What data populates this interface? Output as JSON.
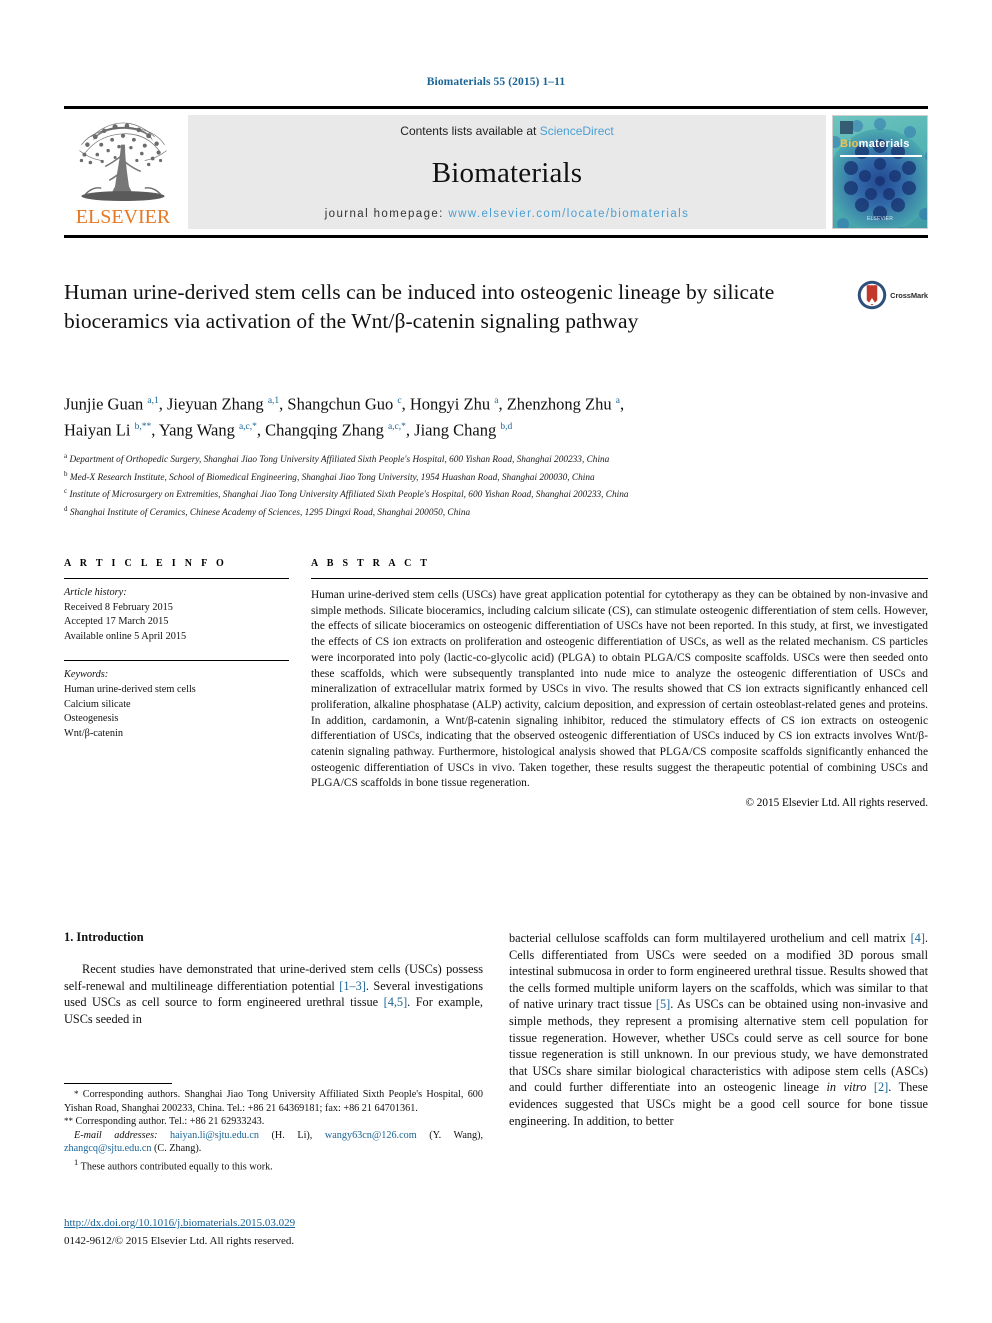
{
  "running_head": "Biomaterials 55 (2015) 1–11",
  "masthead": {
    "publisher": "ELSEVIER",
    "contents_prefix": "Contents lists available at ",
    "contents_link": "ScienceDirect",
    "journal_name": "Biomaterials",
    "homepage_prefix": "journal homepage: ",
    "homepage_url": "www.elsevier.com/locate/biomaterials",
    "cover_title_bio": "Bio",
    "cover_title_materials": "materials",
    "cover_footer": "ELSEVIER"
  },
  "title": "Human urine-derived stem cells can be induced into osteogenic lineage by silicate bioceramics via activation of the Wnt/β-catenin signaling pathway",
  "crossmark_label": "CrossMark",
  "authors_line1": "Junjie Guan a,1, Jieyuan Zhang a,1, Shangchun Guo c, Hongyi Zhu a, Zhenzhong Zhu a,",
  "authors_line2": "Haiyan Li b,**, Yang Wang a,c,*, Changqing Zhang a,c,*, Jiang Chang b,d",
  "affiliations": [
    {
      "mark": "a",
      "text": "Department of Orthopedic Surgery, Shanghai Jiao Tong University Affiliated Sixth People's Hospital, 600 Yishan Road, Shanghai 200233, China"
    },
    {
      "mark": "b",
      "text": "Med-X Research Institute, School of Biomedical Engineering, Shanghai Jiao Tong University, 1954 Huashan Road, Shanghai 200030, China"
    },
    {
      "mark": "c",
      "text": "Institute of Microsurgery on Extremities, Shanghai Jiao Tong University Affiliated Sixth People's Hospital, 600 Yishan Road, Shanghai 200233, China"
    },
    {
      "mark": "d",
      "text": "Shanghai Institute of Ceramics, Chinese Academy of Sciences, 1295 Dingxi Road, Shanghai 200050, China"
    }
  ],
  "article_info": {
    "heading": "A R T I C L E  I N F O",
    "history_label": "Article history:",
    "history": [
      "Received 8 February 2015",
      "Accepted 17 March 2015",
      "Available online 5 April 2015"
    ],
    "keywords_label": "Keywords:",
    "keywords": [
      "Human urine-derived stem cells",
      "Calcium silicate",
      "Osteogenesis",
      "Wnt/β-catenin"
    ]
  },
  "abstract": {
    "heading": "A B S T R A C T",
    "text": "Human urine-derived stem cells (USCs) have great application potential for cytotherapy as they can be obtained by non-invasive and simple methods. Silicate bioceramics, including calcium silicate (CS), can stimulate osteogenic differentiation of stem cells. However, the effects of silicate bioceramics on osteogenic differentiation of USCs have not been reported. In this study, at first, we investigated the effects of CS ion extracts on proliferation and osteogenic differentiation of USCs, as well as the related mechanism. CS particles were incorporated into poly (lactic-co-glycolic acid) (PLGA) to obtain PLGA/CS composite scaffolds. USCs were then seeded onto these scaffolds, which were subsequently transplanted into nude mice to analyze the osteogenic differentiation of USCs and mineralization of extracellular matrix formed by USCs in vivo. The results showed that CS ion extracts significantly enhanced cell proliferation, alkaline phosphatase (ALP) activity, calcium deposition, and expression of certain osteoblast-related genes and proteins. In addition, cardamonin, a Wnt/β-catenin signaling inhibitor, reduced the stimulatory effects of CS ion extracts on osteogenic differentiation of USCs, indicating that the observed osteogenic differentiation of USCs induced by CS ion extracts involves Wnt/β-catenin signaling pathway. Furthermore, histological analysis showed that PLGA/CS composite scaffolds significantly enhanced the osteogenic differentiation of USCs in vivo. Taken together, these results suggest the therapeutic potential of combining USCs and PLGA/CS scaffolds in bone tissue regeneration.",
    "copyright": "© 2015 Elsevier Ltd. All rights reserved."
  },
  "introduction": {
    "heading": "1. Introduction",
    "left_paragraph": "Recent studies have demonstrated that urine-derived stem cells (USCs) possess self-renewal and multilineage differentiation potential [1–3]. Several investigations used USCs as cell source to form engineered urethral tissue [4,5]. For example, USCs seeded in",
    "right_paragraph": "bacterial cellulose scaffolds can form multilayered urothelium and cell matrix [4]. Cells differentiated from USCs were seeded on a modified 3D porous small intestinal submucosa in order to form engineered urethral tissue. Results showed that the cells formed multiple uniform layers on the scaffolds, which was similar to that of native urinary tract tissue [5]. As USCs can be obtained using non-invasive and simple methods, they represent a promising alternative stem cell population for tissue regeneration. However, whether USCs could serve as cell source for bone tissue regeneration is still unknown. In our previous study, we have demonstrated that USCs share similar biological characteristics with adipose stem cells (ASCs) and could further differentiate into an osteogenic lineage in vitro [2]. These evidences suggested that USCs might be a good cell source for bone tissue engineering. In addition, to better"
  },
  "footnotes": {
    "corresponding_1": "Corresponding authors. Shanghai Jiao Tong University Affiliated Sixth People's Hospital, 600 Yishan Road, Shanghai 200233, China. Tel.: +86 21 64369181; fax: +86 21 64701361.",
    "corresponding_2": "Corresponding author. Tel.: +86 21 62933243.",
    "email_label": "E-mail addresses:",
    "email_1": "haiyan.li@sjtu.edu.cn",
    "email_1_name": "(H. Li),",
    "email_2": "wangy63cn@126.com",
    "email_2_name": "(Y. Wang),",
    "email_3": "zhangcq@sjtu.edu.cn",
    "email_3_name": "(C. Zhang).",
    "equal_contrib_mark": "1",
    "equal_contrib": "These authors contributed equally to this work."
  },
  "doi": "http://dx.doi.org/10.1016/j.biomaterials.2015.03.029",
  "issn_line": "0142-9612/© 2015 Elsevier Ltd. All rights reserved.",
  "colors": {
    "link_blue": "#1a6496",
    "sciencedirect_blue": "#4a9fd4",
    "elsevier_orange": "#E87722",
    "cover_teal": "#4aa9ae"
  }
}
